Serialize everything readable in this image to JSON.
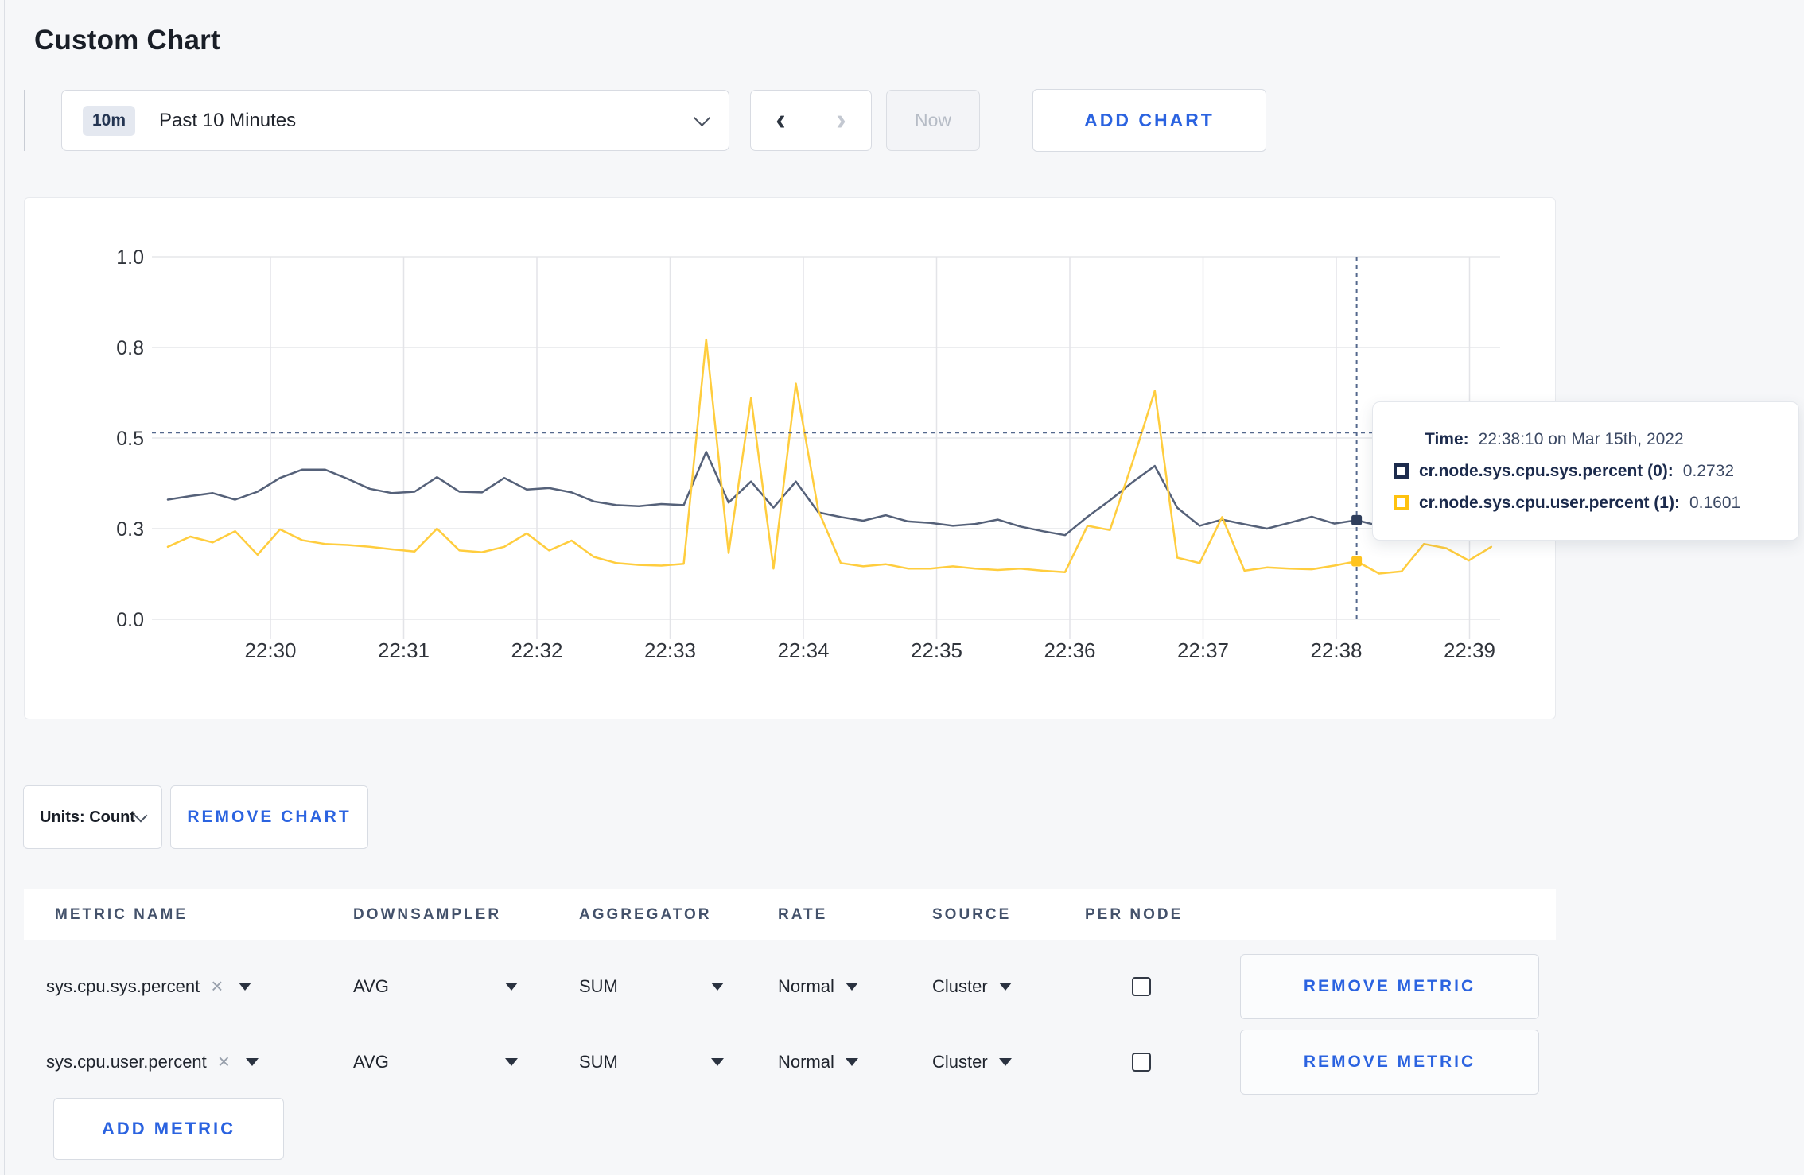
{
  "page": {
    "title": "Custom Chart"
  },
  "colors": {
    "accent_blue": "#2b63e0",
    "series_sys": "#556179",
    "series_user": "#ffcd3e",
    "tooltip_square_sys": "#1c2b4d",
    "tooltip_square_user": "#ffc20e",
    "page_background": "#f6f7f9"
  },
  "icons": {
    "chevron_left": "‹",
    "chevron_right": "›",
    "close": "×"
  },
  "toolbar": {
    "time_window_badge": "10m",
    "time_window_label": "Past 10 Minutes",
    "now_label": "Now",
    "add_chart_label": "ADD CHART"
  },
  "chart_data": {
    "type": "line",
    "title": "",
    "xlabel": "",
    "ylabel": "",
    "ylim": [
      0,
      1
    ],
    "grid": true,
    "legend": "none",
    "x_start_time": "22:29:15",
    "x_step_seconds": 10,
    "x_ticks": [
      "22:30",
      "22:31",
      "22:32",
      "22:33",
      "22:34",
      "22:35",
      "22:36",
      "22:37",
      "22:38",
      "22:39"
    ],
    "y_tick_labels": [
      "0.0",
      "0.3",
      "0.5",
      "0.8",
      "1.0"
    ],
    "y_tick_values": [
      0,
      0.25,
      0.5,
      0.75,
      1.0
    ],
    "crosshair": {
      "x_index": 53,
      "time": "22:38:10",
      "y_value": 0.515
    },
    "series": [
      {
        "name": "cr.node.sys.cpu.sys.percent (0)",
        "color": "#556179",
        "marker_color": "#2f3e5c",
        "values": [
          0.33,
          0.34,
          0.348,
          0.33,
          0.352,
          0.39,
          0.413,
          0.413,
          0.388,
          0.36,
          0.348,
          0.352,
          0.392,
          0.352,
          0.35,
          0.39,
          0.358,
          0.362,
          0.35,
          0.325,
          0.315,
          0.312,
          0.318,
          0.315,
          0.462,
          0.322,
          0.38,
          0.308,
          0.38,
          0.295,
          0.282,
          0.272,
          0.287,
          0.27,
          0.266,
          0.258,
          0.263,
          0.275,
          0.256,
          0.243,
          0.232,
          0.283,
          0.328,
          0.378,
          0.423,
          0.308,
          0.258,
          0.275,
          0.262,
          0.25,
          0.266,
          0.283,
          0.264,
          0.2732,
          0.258,
          0.255,
          0.26,
          0.268,
          0.286,
          0.296
        ]
      },
      {
        "name": "cr.node.sys.cpu.user.percent (1)",
        "color": "#ffcd3e",
        "marker_color": "#ffc31e",
        "values": [
          0.2,
          0.228,
          0.212,
          0.243,
          0.178,
          0.248,
          0.218,
          0.208,
          0.205,
          0.2,
          0.193,
          0.187,
          0.25,
          0.19,
          0.185,
          0.2,
          0.237,
          0.19,
          0.217,
          0.172,
          0.155,
          0.15,
          0.148,
          0.153,
          0.772,
          0.183,
          0.61,
          0.14,
          0.65,
          0.3,
          0.155,
          0.146,
          0.152,
          0.14,
          0.14,
          0.146,
          0.14,
          0.136,
          0.14,
          0.134,
          0.13,
          0.258,
          0.246,
          0.432,
          0.63,
          0.17,
          0.155,
          0.282,
          0.134,
          0.143,
          0.14,
          0.138,
          0.148,
          0.1601,
          0.126,
          0.132,
          0.208,
          0.196,
          0.162,
          0.2
        ]
      }
    ]
  },
  "tooltip": {
    "time_label": "Time:",
    "time_value": "22:38:10 on Mar 15th, 2022",
    "series": [
      {
        "label": "cr.node.sys.cpu.sys.percent (0):",
        "value": "0.2732",
        "color": "#1c2b4d"
      },
      {
        "label": "cr.node.sys.cpu.user.percent (1):",
        "value": "0.1601",
        "color": "#ffc20e"
      }
    ]
  },
  "chart_footer": {
    "units_label": "Units: Count",
    "remove_chart_label": "REMOVE CHART"
  },
  "metrics_table": {
    "headers": [
      "METRIC NAME",
      "DOWNSAMPLER",
      "AGGREGATOR",
      "RATE",
      "SOURCE",
      "PER NODE"
    ],
    "rows": [
      {
        "metric": "sys.cpu.sys.percent",
        "downsampler": "AVG",
        "aggregator": "SUM",
        "rate": "Normal",
        "source": "Cluster",
        "per_node_checked": false,
        "remove_label": "REMOVE METRIC"
      },
      {
        "metric": "sys.cpu.user.percent",
        "downsampler": "AVG",
        "aggregator": "SUM",
        "rate": "Normal",
        "source": "Cluster",
        "per_node_checked": false,
        "remove_label": "REMOVE METRIC"
      }
    ],
    "add_metric_label": "ADD METRIC"
  }
}
